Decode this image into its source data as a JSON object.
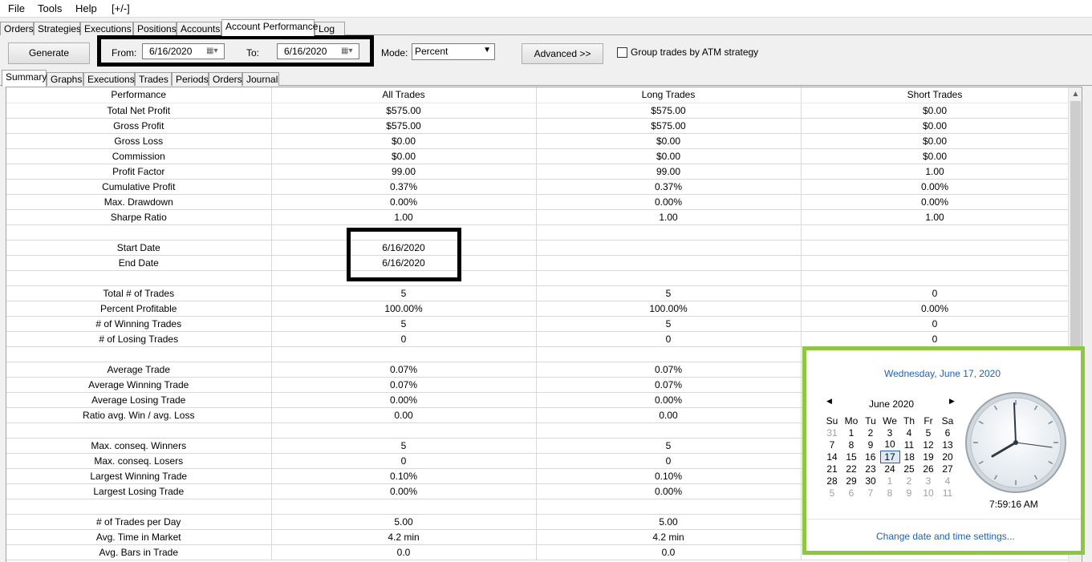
{
  "menu": [
    "File",
    "Tools",
    "Help",
    "[+/-]"
  ],
  "main_tabs": [
    "Orders",
    "Strategies",
    "Executions",
    "Positions",
    "Accounts",
    "Account Performance",
    "Log"
  ],
  "toolbar": {
    "generate": "Generate",
    "from_label": "From:",
    "from_value": "6/16/2020",
    "to_label": "To:",
    "to_value": "6/16/2020",
    "mode_label": "Mode:",
    "mode_value": "Percent",
    "advanced": "Advanced >>",
    "group_label": "Group trades by ATM strategy"
  },
  "sub_tabs": [
    "Summary",
    "Graphs",
    "Executions",
    "Trades",
    "Periods",
    "Orders",
    "Journal"
  ],
  "table": {
    "columns": [
      "Performance",
      "All Trades",
      "Long Trades",
      "Short Trades"
    ],
    "rows": [
      [
        "Total Net Profit",
        "$575.00",
        "$575.00",
        "$0.00"
      ],
      [
        "Gross Profit",
        "$575.00",
        "$575.00",
        "$0.00"
      ],
      [
        "Gross Loss",
        "$0.00",
        "$0.00",
        "$0.00"
      ],
      [
        "Commission",
        "$0.00",
        "$0.00",
        "$0.00"
      ],
      [
        "Profit Factor",
        "99.00",
        "99.00",
        "1.00"
      ],
      [
        "Cumulative Profit",
        "0.37%",
        "0.37%",
        "0.00%"
      ],
      [
        "Max. Drawdown",
        "0.00%",
        "0.00%",
        "0.00%"
      ],
      [
        "Sharpe Ratio",
        "1.00",
        "1.00",
        "1.00"
      ],
      [
        "",
        "",
        "",
        ""
      ],
      [
        "Start Date",
        "6/16/2020",
        "",
        ""
      ],
      [
        "End Date",
        "6/16/2020",
        "",
        ""
      ],
      [
        "",
        "",
        "",
        ""
      ],
      [
        "Total # of Trades",
        "5",
        "5",
        "0"
      ],
      [
        "Percent Profitable",
        "100.00%",
        "100.00%",
        "0.00%"
      ],
      [
        "# of Winning Trades",
        "5",
        "5",
        "0"
      ],
      [
        "# of Losing Trades",
        "0",
        "0",
        "0"
      ],
      [
        "",
        "",
        "",
        ""
      ],
      [
        "Average Trade",
        "0.07%",
        "0.07%",
        ""
      ],
      [
        "Average Winning Trade",
        "0.07%",
        "0.07%",
        ""
      ],
      [
        "Average Losing Trade",
        "0.00%",
        "0.00%",
        ""
      ],
      [
        "Ratio avg. Win / avg. Loss",
        "0.00",
        "0.00",
        ""
      ],
      [
        "",
        "",
        "",
        ""
      ],
      [
        "Max. conseq. Winners",
        "5",
        "5",
        ""
      ],
      [
        "Max. conseq. Losers",
        "0",
        "0",
        ""
      ],
      [
        "Largest Winning Trade",
        "0.10%",
        "0.10%",
        ""
      ],
      [
        "Largest Losing Trade",
        "0.00%",
        "0.00%",
        ""
      ],
      [
        "",
        "",
        "",
        ""
      ],
      [
        "# of Trades per Day",
        "5.00",
        "5.00",
        ""
      ],
      [
        "Avg. Time in Market",
        "4.2 min",
        "4.2 min",
        ""
      ],
      [
        "Avg. Bars in Trade",
        "0.0",
        "0.0",
        ""
      ]
    ]
  },
  "popup": {
    "full_date": "Wednesday, June 17, 2020",
    "month": "June 2020",
    "weekdays": [
      "Su",
      "Mo",
      "Tu",
      "We",
      "Th",
      "Fr",
      "Sa"
    ],
    "weeks": [
      [
        "31",
        "1",
        "2",
        "3",
        "4",
        "5",
        "6"
      ],
      [
        "7",
        "8",
        "9",
        "10",
        "11",
        "12",
        "13"
      ],
      [
        "14",
        "15",
        "16",
        "17",
        "18",
        "19",
        "20"
      ],
      [
        "21",
        "22",
        "23",
        "24",
        "25",
        "26",
        "27"
      ],
      [
        "28",
        "29",
        "30",
        "1",
        "2",
        "3",
        "4"
      ],
      [
        "5",
        "6",
        "7",
        "8",
        "9",
        "10",
        "11"
      ]
    ],
    "time": "7:59:16 AM",
    "change_link": "Change date and time settings..."
  }
}
